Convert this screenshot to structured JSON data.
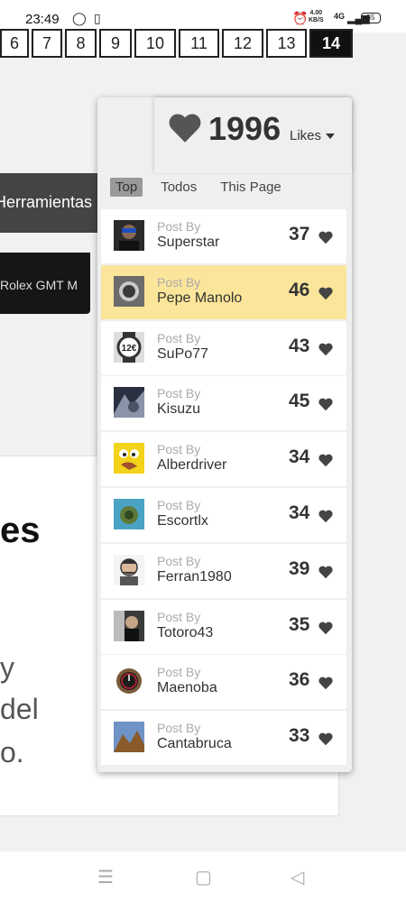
{
  "status_bar": {
    "time": "23:49",
    "speed_value": "4.00",
    "speed_unit": "KB/S",
    "network": "4G",
    "battery": "55"
  },
  "pagination": {
    "pages": [
      "6",
      "7",
      "8",
      "9",
      "10",
      "11",
      "12",
      "13",
      "14"
    ],
    "active": "14"
  },
  "background": {
    "tools_button": "Herramientas",
    "rolex_button": "Rolex GMT M",
    "heading_fragment": "es",
    "paragraph_fragments": [
      "y",
      "del",
      "o."
    ]
  },
  "likes_widget": {
    "count": "1996",
    "label": "Likes",
    "tabs": [
      "Top",
      "Todos",
      "This Page"
    ],
    "active_tab": "Top",
    "post_by_label": "Post By",
    "entries": [
      {
        "user": "Superstar",
        "score": "37",
        "highlight": false
      },
      {
        "user": "Pepe Manolo",
        "score": "46",
        "highlight": true
      },
      {
        "user": "SuPo77",
        "score": "43",
        "highlight": false
      },
      {
        "user": "Kisuzu",
        "score": "45",
        "highlight": false
      },
      {
        "user": "Alberdriver",
        "score": "34",
        "highlight": false
      },
      {
        "user": "Escortlx",
        "score": "34",
        "highlight": false
      },
      {
        "user": "Ferran1980",
        "score": "39",
        "highlight": false
      },
      {
        "user": "Totoro43",
        "score": "35",
        "highlight": false
      },
      {
        "user": "Maenoba",
        "score": "36",
        "highlight": false
      },
      {
        "user": "Cantabruca",
        "score": "33",
        "highlight": false
      }
    ],
    "colors": {
      "highlight": "#fbe59a",
      "heart": "#444444"
    }
  }
}
